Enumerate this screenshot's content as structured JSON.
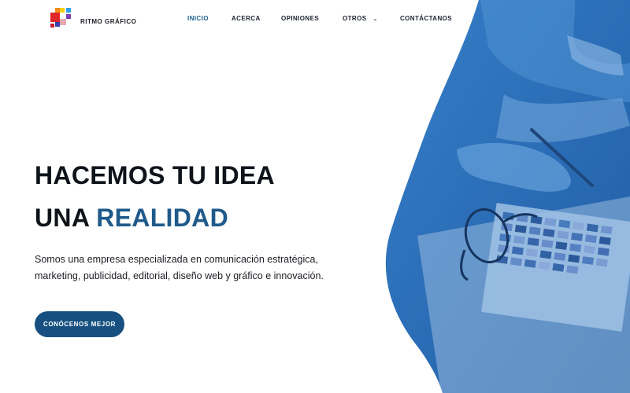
{
  "brand": {
    "name": "RITMO GRÁFICO",
    "logo_icon": "pixel-squares-logo-icon"
  },
  "nav": {
    "items": [
      {
        "label": "INICIO",
        "active": true
      },
      {
        "label": "ACERCA",
        "active": false
      },
      {
        "label": "OPINIONES",
        "active": false
      },
      {
        "label": "OTROS",
        "active": false,
        "dropdown": true,
        "icon": "chevron-down-icon"
      },
      {
        "label": "CONTÁCTANOS",
        "active": false
      }
    ]
  },
  "hero": {
    "headline_line1": "HACEMOS TU IDEA",
    "headline_line2_prefix": "UNA",
    "headline_line2_accent": "REALIDAD",
    "description_line1": "Somos una empresa especializada en comunicación estratégica,",
    "description_line2": "marketing, publicidad, editorial, diseño web y gráfico e innovación.",
    "cta_label": "CONÓCENOS MEJOR"
  },
  "colors": {
    "accent": "#1f5a8a",
    "button": "#175080",
    "nav_active": "#1f5f8f",
    "hero_overlay": "#2b6fb8"
  }
}
